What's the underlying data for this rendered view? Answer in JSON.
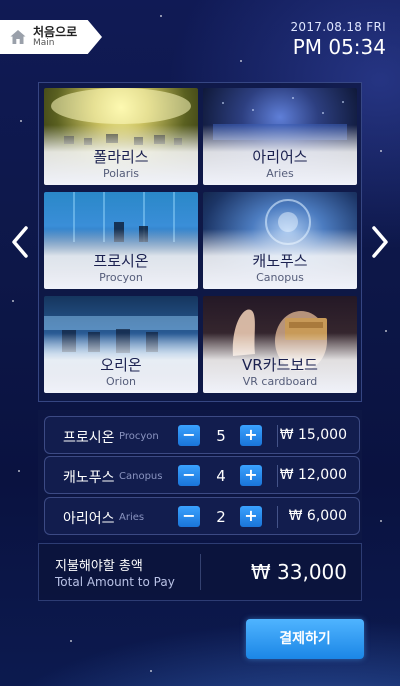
{
  "header": {
    "home_label_ko": "처음으로",
    "home_label_en": "Main",
    "date": "2017.08.18 FRI",
    "time": "PM 05:34"
  },
  "attractions": [
    {
      "name_ko": "폴라리스",
      "name_en": "Polaris"
    },
    {
      "name_ko": "아리어스",
      "name_en": "Aries"
    },
    {
      "name_ko": "프로시온",
      "name_en": "Procyon"
    },
    {
      "name_ko": "캐노푸스",
      "name_en": "Canopus"
    },
    {
      "name_ko": "오리온",
      "name_en": "Orion"
    },
    {
      "name_ko": "VR카드보드",
      "name_en": "VR cardboard"
    }
  ],
  "order": [
    {
      "name_ko": "프로시온",
      "name_en": "Procyon",
      "qty": "5",
      "price": "₩ 15,000"
    },
    {
      "name_ko": "캐노푸스",
      "name_en": "Canopus",
      "qty": "4",
      "price": "₩ 12,000"
    },
    {
      "name_ko": "아리어스",
      "name_en": "Aries",
      "qty": "2",
      "price": "₩ 6,000"
    }
  ],
  "controls": {
    "minus": "−",
    "plus": "+"
  },
  "total": {
    "label_ko": "지불해야할 총액",
    "label_en": "Total Amount to Pay",
    "amount": "₩ 33,000"
  },
  "pay_button": "결제하기",
  "colors": {
    "accent": "#2a8cf0",
    "background": "#0d1748"
  }
}
